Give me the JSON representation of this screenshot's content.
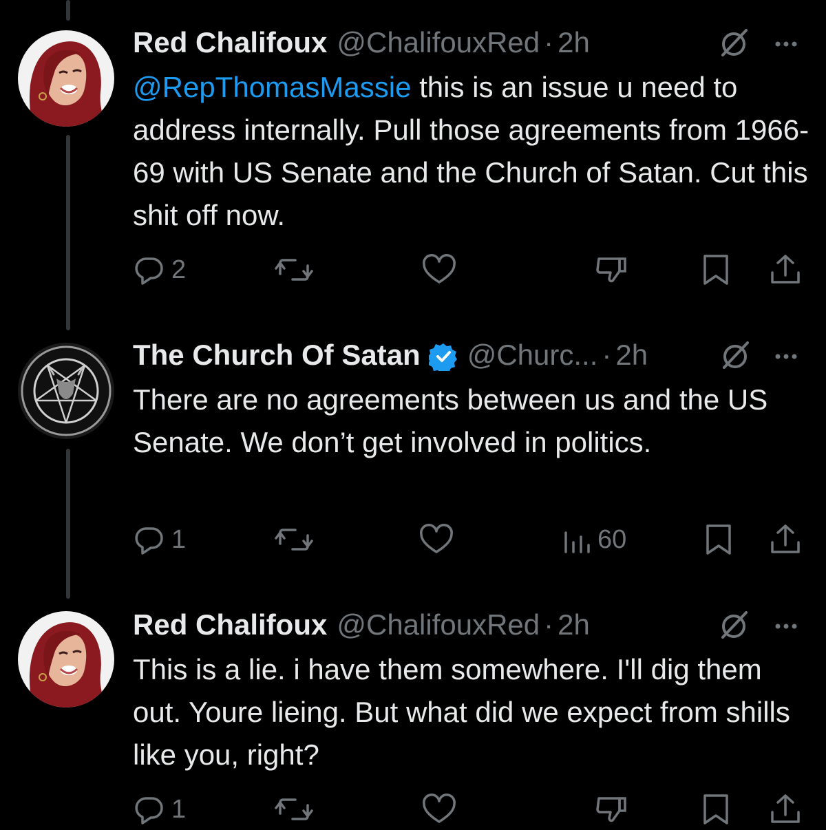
{
  "tweets": [
    {
      "name": "Red Chalifoux",
      "handle": "@ChalifouxRed",
      "dot": "·",
      "time": "2h",
      "verified": false,
      "mention": "@RepThomasMassie",
      "text": " this is an issue u need to address internally. Pull those agreements from 1966-69 with US Senate and the Church of Satan. Cut this shit off now.",
      "replies": "2",
      "icons": [
        "reply-icon",
        "retweet-icon",
        "like-icon",
        "dislike-icon",
        "bookmark-icon",
        "share-icon"
      ]
    },
    {
      "name": "The Church Of Satan",
      "handle": "@Churc...",
      "dot": "·",
      "time": "2h",
      "verified": true,
      "verified_color": "#1d9bf0",
      "mention": "",
      "text": "There are no agreements between us and the US Senate. We don’t get involved in politics.",
      "replies": "1",
      "views": "60",
      "icons": [
        "reply-icon",
        "retweet-icon",
        "like-icon",
        "views-icon",
        "bookmark-icon",
        "share-icon"
      ]
    },
    {
      "name": "Red Chalifoux",
      "handle": "@ChalifouxRed",
      "dot": "·",
      "time": "2h",
      "verified": false,
      "mention": "",
      "text": "This is a lie. i have them somewhere. I'll dig them out. Youre lieing. But what did we expect from shills like you, right?",
      "replies": "1",
      "icons": [
        "reply-icon",
        "retweet-icon",
        "like-icon",
        "dislike-icon",
        "bookmark-icon",
        "share-icon"
      ]
    }
  ],
  "colors": {
    "background": "#000000",
    "text": "#e7e9ea",
    "secondary": "#71767b",
    "mention": "#1d9bf0",
    "verified": "#1d9bf0",
    "thread_line": "#333639"
  }
}
